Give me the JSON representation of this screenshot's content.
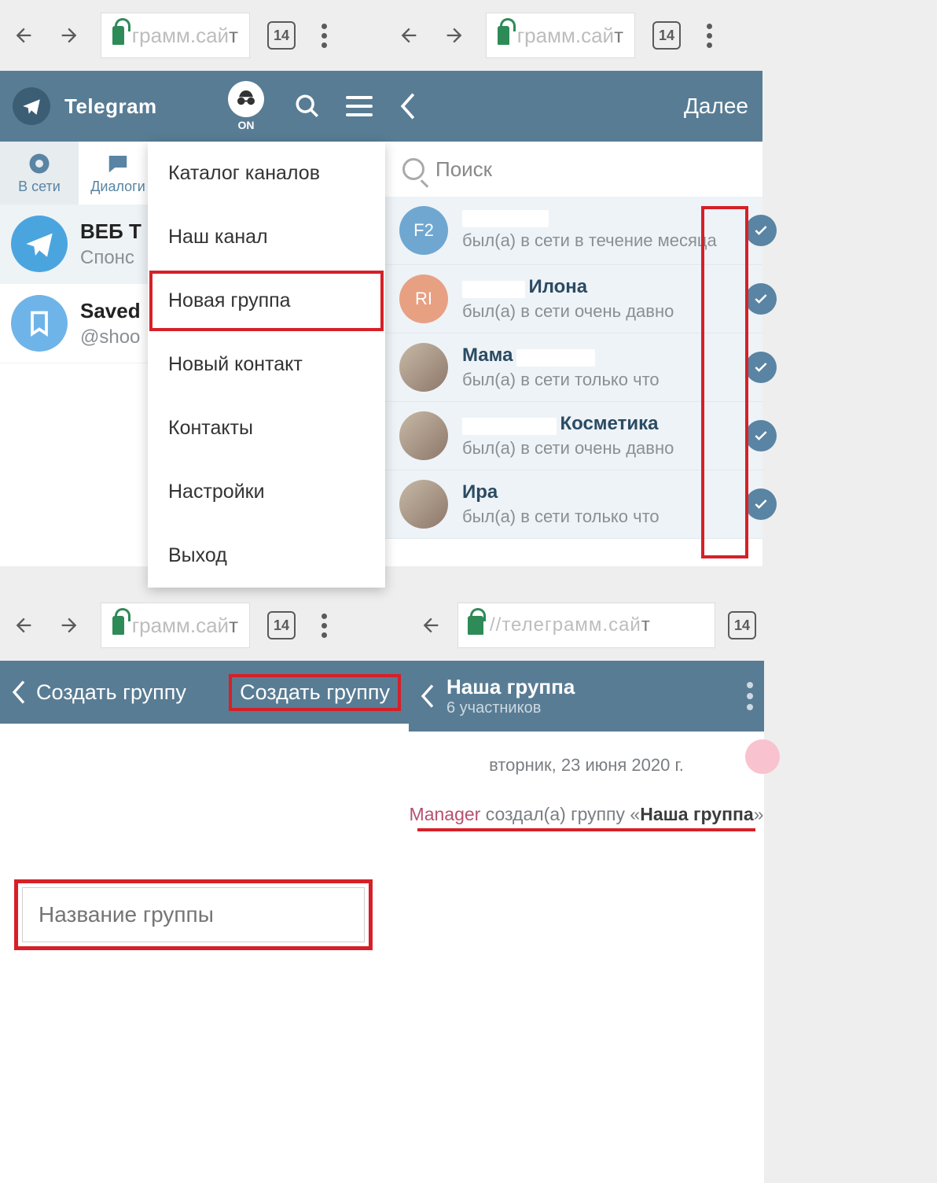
{
  "browser": {
    "url_visible_light": "грамм.сай",
    "url_trail": "т",
    "url_full_light": "//телеграмм.сай",
    "tab_count": "14"
  },
  "panel1": {
    "app_title": "Telegram",
    "incognito_label": "ON",
    "tabs": {
      "online": "В сети",
      "dialogs": "Диалоги"
    },
    "chat1": {
      "name": "ВЕБ Т",
      "sub": "Спонс"
    },
    "chat2": {
      "name": "Saved",
      "sub": "@shoo"
    },
    "menu": {
      "catalog": "Каталог каналов",
      "our_channel": "Наш канал",
      "new_group": "Новая группа",
      "new_contact": "Новый контакт",
      "contacts": "Контакты",
      "settings": "Настройки",
      "logout": "Выход"
    }
  },
  "panel2": {
    "next_label": "Далее",
    "search_placeholder": "Поиск",
    "contacts": [
      {
        "avatar_text": "F2",
        "avatar_color": "#6fa7d1",
        "name_mask_w": 110,
        "name_suffix": "",
        "status": "был(а) в сети в течение месяца"
      },
      {
        "avatar_text": "RI",
        "avatar_color": "#e8a083",
        "name_mask_w": 80,
        "name_suffix": "Илона",
        "status": "был(а) в сети очень давно"
      },
      {
        "avatar_text": "",
        "avatar_color": "photo",
        "name_mask_w": 0,
        "name_prefix": "Мама",
        "name_mask_after": 100,
        "status": "был(а) в сети только что"
      },
      {
        "avatar_text": "",
        "avatar_color": "photo",
        "name_mask_w": 120,
        "name_suffix": "Косметика",
        "status": "был(а) в сети очень давно"
      },
      {
        "avatar_text": "",
        "avatar_color": "photo",
        "name_mask_w": 0,
        "name_prefix": "Ира",
        "status": "был(а) в сети только что"
      }
    ]
  },
  "panel3": {
    "header_left": "Создать группу",
    "header_right": "Создать группу",
    "input_placeholder": "Название группы"
  },
  "panel4": {
    "group_title": "Наша группа",
    "members": "6 участников",
    "date": "вторник, 23 июня 2020 г.",
    "sys_user": "Manager",
    "sys_action": " создал(а) группу «",
    "sys_group": "Наша группа",
    "sys_close": "»"
  }
}
